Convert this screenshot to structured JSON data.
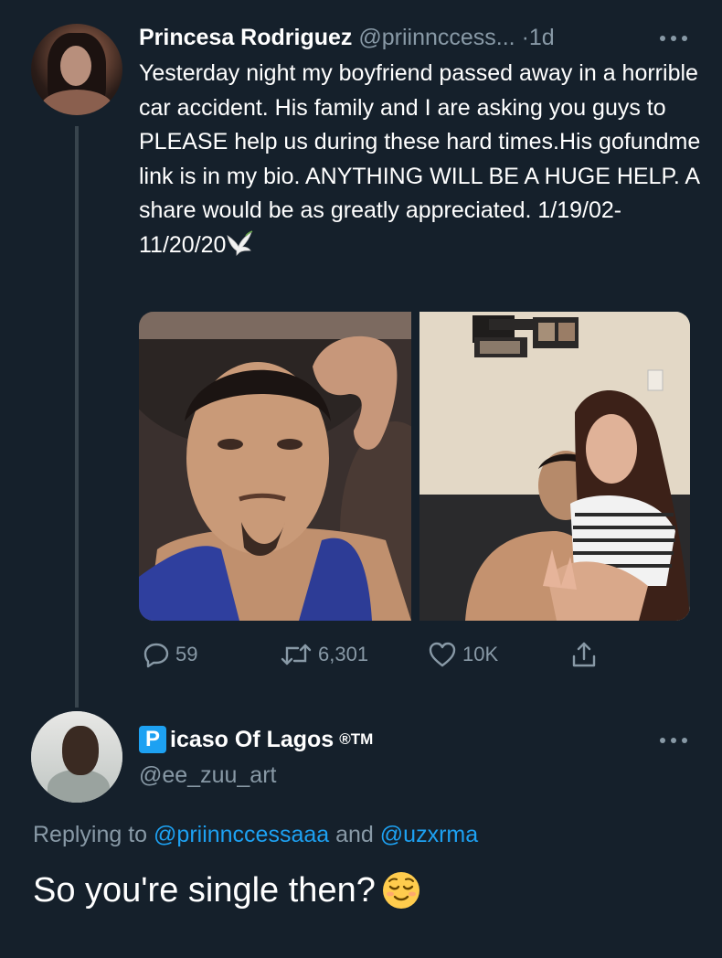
{
  "tweet": {
    "author": {
      "display_name": "Princesa Rodriguez",
      "handle": "@priinnccess...",
      "avatar": "avatar-photo"
    },
    "separator": "·",
    "time": "1d",
    "more_icon": "more-horizontal-icon",
    "text": "Yesterday night my boyfriend passed away in a horrible car accident. His family and I are asking you guys to PLEASE help us during these hard times.His gofundme link is in my bio. ANYTHING WILL BE A HUGE HELP. A share would be as greatly appreciated. 1/19/02-11/20/20",
    "trailing_emoji": "dove-icon",
    "media": [
      {
        "icon": "photo",
        "subject": "selfie-photo"
      },
      {
        "icon": "photo",
        "subject": "couple-photo"
      }
    ],
    "actions": {
      "reply": {
        "icon": "reply-icon",
        "count": "59"
      },
      "retweet": {
        "icon": "retweet-icon",
        "count": "6,301"
      },
      "like": {
        "icon": "heart-icon",
        "count": "10K"
      },
      "share": {
        "icon": "share-icon"
      }
    }
  },
  "reply": {
    "author": {
      "badge_letter": "P",
      "display_name_rest": "icaso Of Lagos",
      "trademark": "®TM",
      "handle": "@ee_zuu_art",
      "avatar": "avatar-photo"
    },
    "more_icon": "more-horizontal-icon",
    "replying_prefix": "Replying to",
    "mention_1": "@priinnccessaaa",
    "conjunction": "and",
    "mention_2": "@uzxrma",
    "text": "So you're single then?",
    "trailing_emoji": "relieved-face-icon"
  },
  "colors": {
    "background": "#15202b",
    "primary_text": "#ffffff",
    "secondary_text": "#8899a6",
    "accent": "#1da1f2",
    "thread_line": "#38444d"
  }
}
